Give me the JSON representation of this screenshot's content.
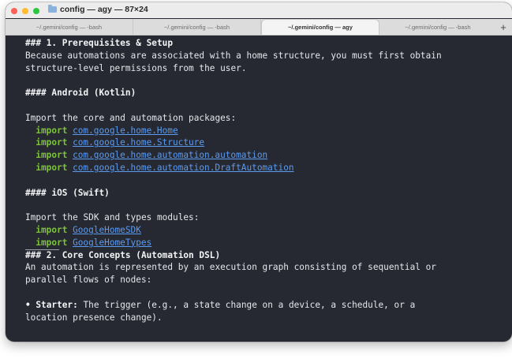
{
  "window": {
    "title": "config — agy — 87×24",
    "folder_icon": "folder-icon"
  },
  "tabs": [
    {
      "label": "~/.gemini/config — -bash",
      "active": false
    },
    {
      "label": "~/.gemini/config — -bash",
      "active": false
    },
    {
      "label": "~/.gemini/config — agy",
      "active": true
    },
    {
      "label": "~/.gemini/config — -bash",
      "active": false
    }
  ],
  "new_tab_label": "+",
  "colors": {
    "terminal_bg": "#262932",
    "text": "#e5e7eb",
    "keyword": "#7ec13a",
    "link": "#5b9bf0"
  },
  "terminal": {
    "h1": "### 1. Prerequisites & Setup",
    "p1a": "Because automations are associated with a home structure, you must first obtain",
    "p1b": "structure-level permissions from the user.",
    "h_android": "#### Android (Kotlin)",
    "android_intro": "Import the core and automation packages:",
    "kw_import": "import",
    "android_imports": [
      "com.google.home.Home",
      "com.google.home.Structure",
      "com.google.home.automation.automation",
      "com.google.home.automation.DraftAutomation"
    ],
    "h_ios": "#### iOS (Swift)",
    "ios_intro": "Import the SDK and types modules:",
    "ios_imports": [
      "GoogleHomeSDK",
      "GoogleHomeTypes"
    ],
    "h2": "### 2. Core Concepts (Automation DSL)",
    "p2a": "An automation is represented by an execution graph consisting of sequential or",
    "p2b": "parallel flows of nodes:",
    "bullet_marker": "• ",
    "starter_label": "Starter:",
    "starter_text_a": " The trigger (e.g., a state change on a device, a schedule, or a",
    "starter_text_b": "location presence change)."
  }
}
